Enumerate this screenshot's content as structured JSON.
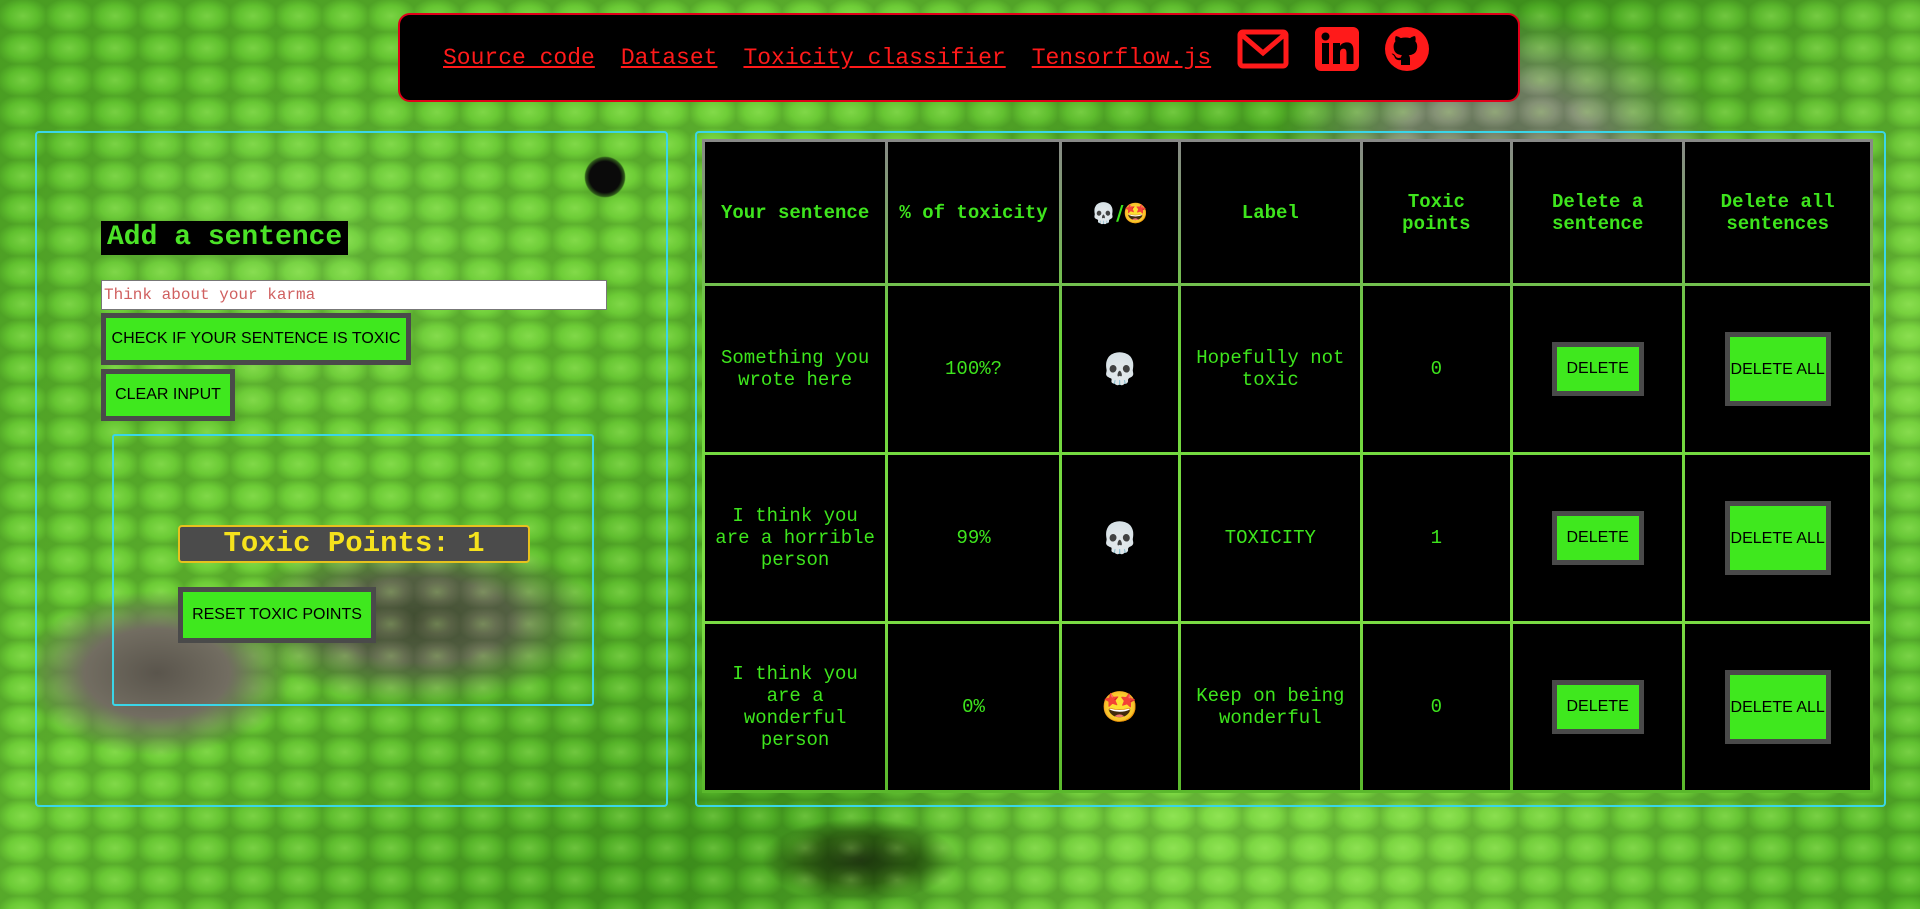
{
  "nav": {
    "links": [
      "Source code",
      "Dataset",
      "Toxicity classifier",
      "Tensorflow.js"
    ],
    "icons": [
      "email-icon",
      "linkedin-icon",
      "github-icon"
    ],
    "accent": "#ff1a1a"
  },
  "left": {
    "title": "Add a sentence",
    "input_placeholder": "Think about your karma",
    "input_value": "",
    "check_button": "CHECK IF YOUR SENTENCE IS TOXIC",
    "clear_button": "CLEAR INPUT",
    "points_text": "Toxic Points: 1",
    "reset_button": "RESET TOXIC POINTS"
  },
  "table": {
    "headers": [
      "Your sentence",
      "% of toxicity",
      "💀/🤩",
      "Label",
      "Toxic points",
      "Delete a sentence",
      "Delete all sentences"
    ],
    "rows": [
      {
        "sentence": "Something you wrote here",
        "percent": "100%?",
        "emoji": "💀",
        "label": "Hopefully not toxic",
        "points": "0",
        "delete": "DELETE",
        "delete_all": "DELETE ALL"
      },
      {
        "sentence": "I think you are a horrible person",
        "percent": "99%",
        "emoji": "💀",
        "label": "TOXICITY",
        "points": "1",
        "delete": "DELETE",
        "delete_all": "DELETE ALL"
      },
      {
        "sentence": "I think you are a wonderful person",
        "percent": "0%",
        "emoji": "🤩",
        "label": "Keep on being wonderful",
        "points": "0",
        "delete": "DELETE",
        "delete_all": "DELETE ALL"
      }
    ]
  },
  "colors": {
    "text_green": "#3ee51d",
    "button_green": "#3fe81e",
    "panel_border": "#3ad6e8",
    "points_yellow": "#f6e21c"
  }
}
